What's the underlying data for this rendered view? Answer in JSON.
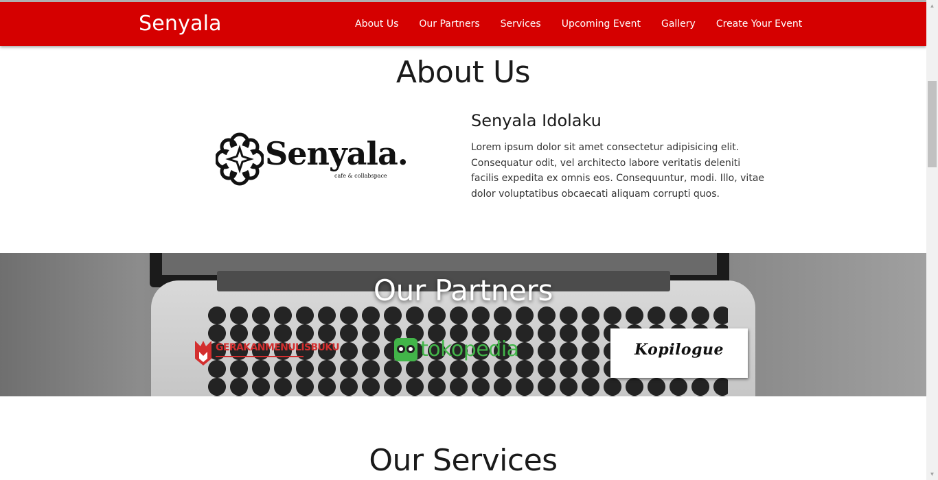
{
  "navbar": {
    "brand": "Senyala",
    "links": [
      "About Us",
      "Our Partners",
      "Services",
      "Upcoming Event",
      "Gallery",
      "Create Your Event"
    ],
    "background": "#d50000"
  },
  "about": {
    "title": "About Us",
    "logo": {
      "wordmark": "Senyala.",
      "tagline": "cafe & collabspace"
    },
    "heading": "Senyala Idolaku",
    "text": "Lorem ipsum dolor sit amet consectetur adipisicing elit. Consequatur odit, vel architecto labore veritatis deleniti facilis expedita ex omnis eos. Consequuntur, modi. Illo, vitae dolor voluptatibus obcaecati aliquam corrupti quos."
  },
  "partners": {
    "title": "Our Partners",
    "items": [
      {
        "name": "GERAKANMENULISBUKU",
        "color": "#d32f2f"
      },
      {
        "name": "tokopedia",
        "color": "#42b549"
      },
      {
        "name": "Kopilogue",
        "color": "#111111"
      }
    ]
  },
  "services": {
    "title": "Our Services"
  }
}
